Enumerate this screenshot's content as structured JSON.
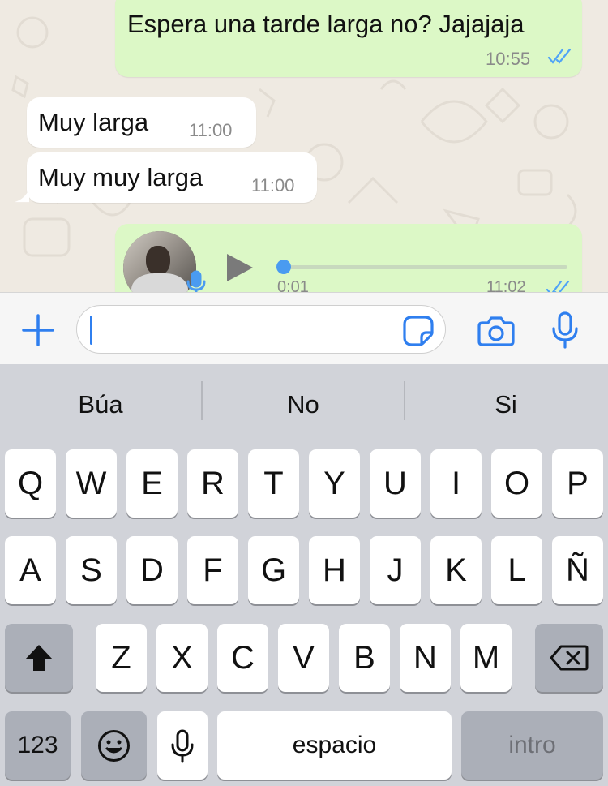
{
  "chat": {
    "messages": [
      {
        "direction": "out",
        "text": "Espera una tarde larga no? Jajajaja",
        "time": "10:55",
        "read": true
      },
      {
        "direction": "in",
        "text": "Muy larga",
        "time": "11:00"
      },
      {
        "direction": "in",
        "text": "Muy muy larga",
        "time": "11:00"
      }
    ],
    "voice_note": {
      "duration": "0:01",
      "time": "11:02",
      "progress": 0.0,
      "read": true
    }
  },
  "composer": {
    "text": "",
    "icons": {
      "attach": "plus-icon",
      "sticker": "sticker-icon",
      "camera": "camera-icon",
      "voice": "microphone-icon"
    }
  },
  "keyboard": {
    "suggestions": [
      "Búa",
      "No",
      "Si"
    ],
    "rows": [
      [
        "Q",
        "W",
        "E",
        "R",
        "T",
        "Y",
        "U",
        "I",
        "O",
        "P"
      ],
      [
        "A",
        "S",
        "D",
        "F",
        "G",
        "H",
        "J",
        "K",
        "L",
        "Ñ"
      ],
      [
        "Z",
        "X",
        "C",
        "V",
        "B",
        "N",
        "M"
      ]
    ],
    "numbers_label": "123",
    "space_label": "espacio",
    "return_label": "intro"
  },
  "colors": {
    "accent": "#2f7fef",
    "outgoing_bubble": "#dcf8c6",
    "incoming_bubble": "#ffffff",
    "read_ticks": "#4fa3f7"
  }
}
